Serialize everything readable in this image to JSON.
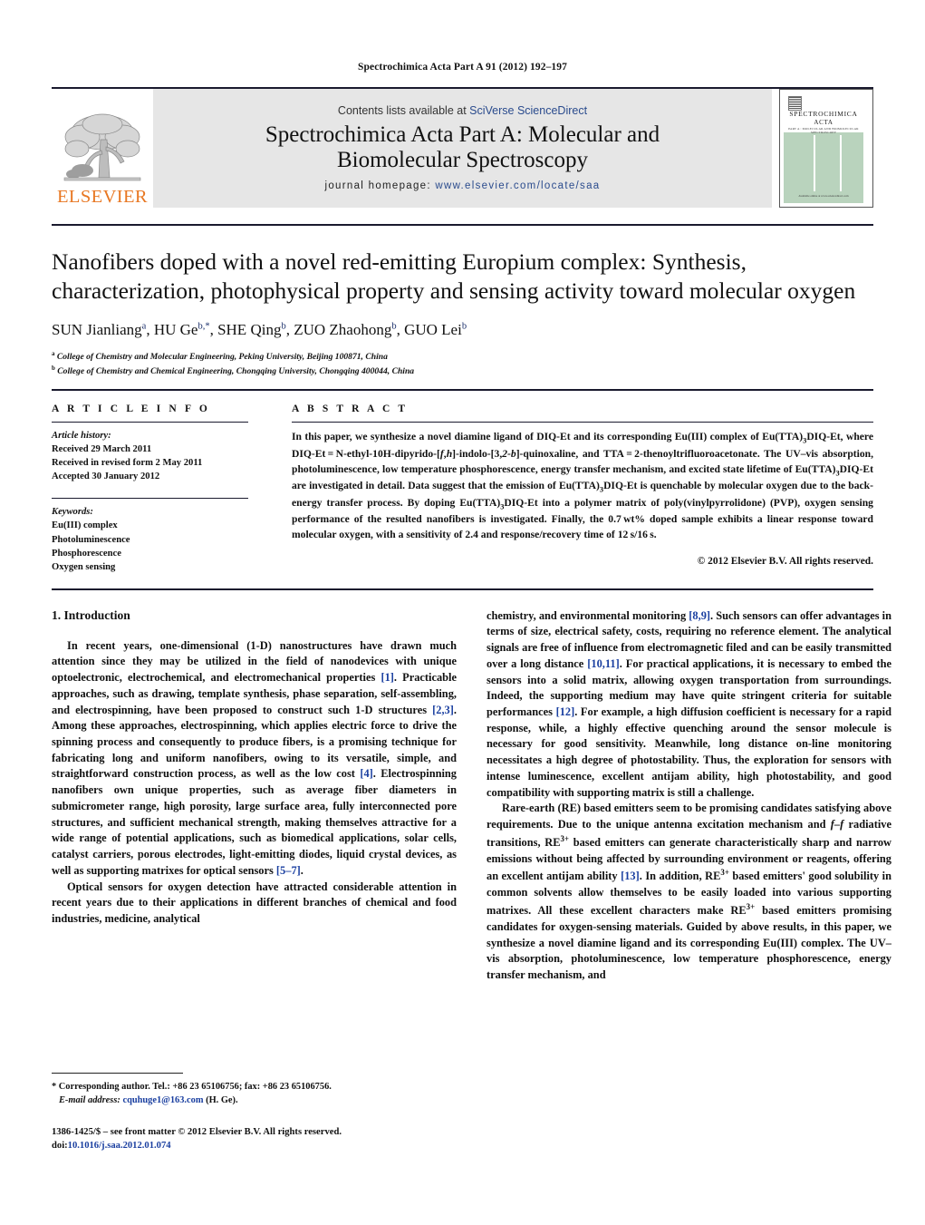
{
  "running_head": "Spectrochimica Acta Part A 91 (2012) 192–197",
  "masthead": {
    "publisher_name": "ELSEVIER",
    "contents_prefix": "Contents lists available at ",
    "contents_link": "SciVerse ScienceDirect",
    "journal_title_line1": "Spectrochimica Acta Part A: Molecular and",
    "journal_title_line2": "Biomolecular Spectroscopy",
    "homepage_label": "journal homepage:",
    "homepage_url": "www.elsevier.com/locate/saa",
    "cover": {
      "title_line1": "SPECTROCHIMICA",
      "title_line2": "ACTA",
      "subtitle": "PART A : MOLECULAR AND BIOMOLECULAR SPECTROSCOPY",
      "footer": "Available online at www.sciencedirect.com"
    }
  },
  "article": {
    "title": "Nanofibers doped with a novel red-emitting Europium complex: Synthesis, characterization, photophysical property and sensing activity toward molecular oxygen",
    "authors": [
      {
        "name": "SUN Jianliang",
        "marks": "a"
      },
      {
        "name": "HU Ge",
        "marks": "b,*"
      },
      {
        "name": "SHE Qing",
        "marks": "b"
      },
      {
        "name": "ZUO Zhaohong",
        "marks": "b"
      },
      {
        "name": "GUO Lei",
        "marks": "b"
      }
    ],
    "affiliations": [
      {
        "mark": "a",
        "text": "College of Chemistry and Molecular Engineering, Peking University, Beijing 100871, China"
      },
      {
        "mark": "b",
        "text": "College of Chemistry and Chemical Engineering, Chongqing University, Chongqing 400044, China"
      }
    ]
  },
  "info": {
    "heading": "A R T I C L E    I N F O",
    "history_label": "Article history:",
    "history": [
      "Received 29 March 2011",
      "Received in revised form 2 May 2011",
      "Accepted 30 January 2012"
    ],
    "keywords_label": "Keywords:",
    "keywords": [
      "Eu(III) complex",
      "Photoluminescence",
      "Phosphorescence",
      "Oxygen sensing"
    ]
  },
  "abstract": {
    "heading": "A B S T R A C T",
    "copyright": "© 2012 Elsevier B.V. All rights reserved."
  },
  "body": {
    "section1_heading": "1.  Introduction"
  },
  "footnotes": {
    "corresponding": "* Corresponding author. Tel.: +86 23 65106756; fax: +86 23 65106756.",
    "email_label": "E-mail address:",
    "email": "cquhuge1@163.com",
    "email_owner": "(H. Ge).",
    "imprint_line1": "1386-1425/$ – see front matter © 2012 Elsevier B.V. All rights reserved.",
    "doi_label": "doi:",
    "doi": "10.1016/j.saa.2012.01.074"
  },
  "colors": {
    "link": "#2a4b8d",
    "reference": "#1a3fa0",
    "elsevier_orange": "#e87722",
    "band_gray": "#e6e6e6",
    "cover_green": "#b9d3bd"
  }
}
